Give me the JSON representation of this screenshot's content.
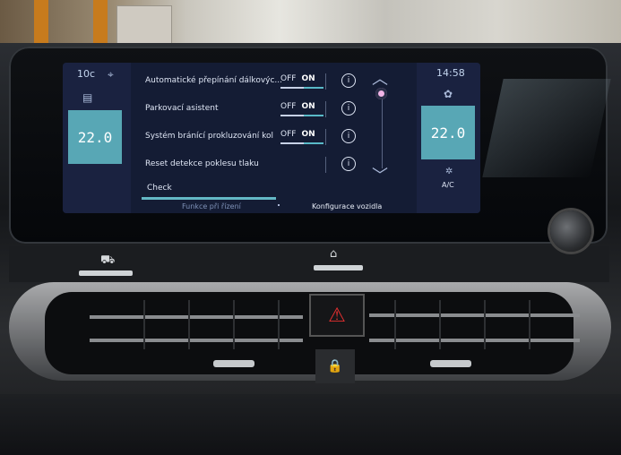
{
  "screen": {
    "left_panel": {
      "temp_small": "10",
      "temp_unit": "c",
      "setpoint": "22.0"
    },
    "right_panel": {
      "clock": "14:58",
      "setpoint": "22.0",
      "ac_label": "A/C"
    },
    "rows": [
      {
        "label": "Automatické přepínání dálkovýc...",
        "toggle_off": "OFF",
        "toggle_on": "ON",
        "state": "on"
      },
      {
        "label": "Parkovací asistent",
        "toggle_off": "OFF",
        "toggle_on": "ON",
        "state": "on"
      },
      {
        "label": "Systém bránící prokluzování kol",
        "toggle_off": "OFF",
        "toggle_on": "ON",
        "state": "on"
      },
      {
        "label": "Reset detekce poklesu tlaku"
      }
    ],
    "check_label": "Check",
    "tabs": [
      {
        "label": "Funkce při řízení",
        "active": false
      },
      {
        "label": "Konfigurace vozidla",
        "active": true
      }
    ]
  },
  "icons": [
    "location-pin-icon",
    "seat-heat-icon",
    "fan-settings-icon",
    "info-icon",
    "chevron-up-icon",
    "chevron-down-icon",
    "car-icon",
    "home-icon",
    "hazard-icon",
    "lock-icon"
  ],
  "colors": {
    "accent": "#59b9c7",
    "scroll_dot": "#f1b4e6",
    "screen_bg": "#141c34"
  }
}
